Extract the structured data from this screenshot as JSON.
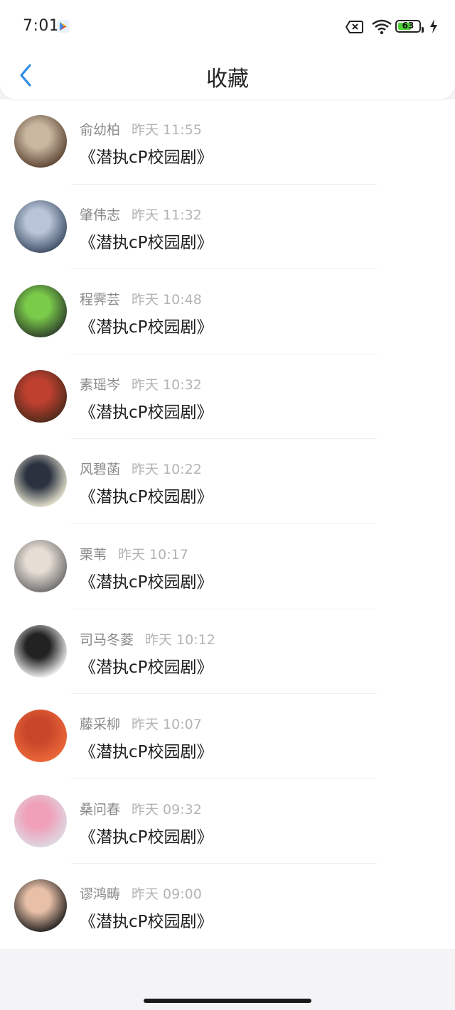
{
  "status_bar": {
    "time": "7:01",
    "battery": "63",
    "battery_fraction": 0.63
  },
  "header": {
    "title": "收藏"
  },
  "favorites": [
    {
      "name": "俞幼柏",
      "time": "昨天 11:55",
      "title": "《潜执cP校园剧》",
      "avatar_colors": [
        "#5a4030",
        "#c8b8a0"
      ]
    },
    {
      "name": "肇伟志",
      "time": "昨天 11:32",
      "title": "《潜执cP校园剧》",
      "avatar_colors": [
        "#3a4a60",
        "#b8c4d8"
      ]
    },
    {
      "name": "程霁芸",
      "time": "昨天 10:48",
      "title": "《潜执cP校园剧》",
      "avatar_colors": [
        "#2d3b2a",
        "#7acb4a"
      ]
    },
    {
      "name": "素瑶岑",
      "time": "昨天 10:32",
      "title": "《潜执cP校园剧》",
      "avatar_colors": [
        "#4a2a1a",
        "#c04030"
      ]
    },
    {
      "name": "风碧菡",
      "time": "昨天 10:22",
      "title": "《潜执cP校园剧》",
      "avatar_colors": [
        "#f2efd8",
        "#2a3240"
      ]
    },
    {
      "name": "栗苇",
      "time": "昨天 10:17",
      "title": "《潜执cP校园剧》",
      "avatar_colors": [
        "#6a6a6a",
        "#e6ddd4"
      ]
    },
    {
      "name": "司马冬菱",
      "time": "昨天 10:12",
      "title": "《潜执cP校园剧》",
      "avatar_colors": [
        "#ffffff",
        "#222222"
      ]
    },
    {
      "name": "藤采柳",
      "time": "昨天 10:07",
      "title": "《潜执cP校园剧》",
      "avatar_colors": [
        "#ee6a3a",
        "#c8462a"
      ]
    },
    {
      "name": "桑问春",
      "time": "昨天 09:32",
      "title": "《潜执cP校园剧》",
      "avatar_colors": [
        "#dcdce4",
        "#f0a0b8"
      ]
    },
    {
      "name": "谬鸿畴",
      "time": "昨天 09:00",
      "title": "《潜执cP校园剧》",
      "avatar_colors": [
        "#1a1a1a",
        "#e8c0a8"
      ]
    }
  ],
  "colors": {
    "accent": "#2f8de4",
    "title_text": "#1e1e1e",
    "meta_text": "#8a8a8a"
  }
}
